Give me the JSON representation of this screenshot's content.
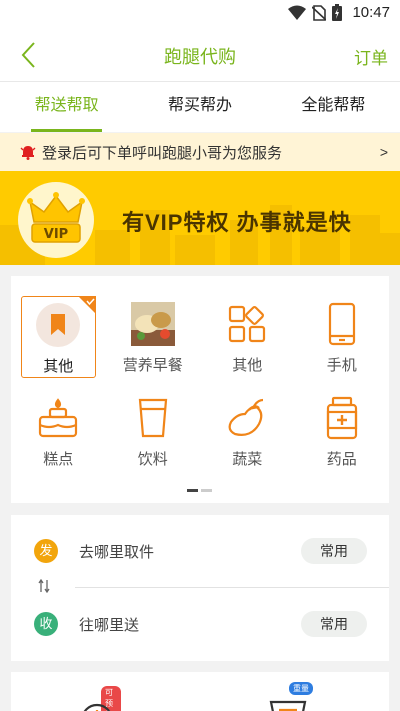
{
  "status_bar": {
    "time": "10:47"
  },
  "header": {
    "title": "跑腿代购",
    "order_label": "订单"
  },
  "tabs": [
    {
      "label": "帮送帮取",
      "active": true
    },
    {
      "label": "帮买帮办",
      "active": false
    },
    {
      "label": "全能帮帮",
      "active": false
    }
  ],
  "notice": {
    "text": "登录后可下单呼叫跑腿小哥为您服务",
    "arrow": ">"
  },
  "vip": {
    "badge_text": "VIP",
    "slogan": "有VIP特权  办事就是快"
  },
  "categories": [
    {
      "label": "其他",
      "icon": "bookmark-icon",
      "selected": true
    },
    {
      "label": "营养早餐",
      "icon": "breakfast-photo",
      "selected": false
    },
    {
      "label": "其他",
      "icon": "grid-shapes-icon",
      "selected": false
    },
    {
      "label": "手机",
      "icon": "phone-icon",
      "selected": false
    },
    {
      "label": "糕点",
      "icon": "cake-icon",
      "selected": false
    },
    {
      "label": "饮料",
      "icon": "cup-icon",
      "selected": false
    },
    {
      "label": "蔬菜",
      "icon": "eggplant-icon",
      "selected": false
    },
    {
      "label": "药品",
      "icon": "medicine-icon",
      "selected": false
    }
  ],
  "address": {
    "pickup": {
      "badge": "发",
      "placeholder": "去哪里取件",
      "common_label": "常用"
    },
    "deliver": {
      "badge": "收",
      "placeholder": "往哪里送",
      "common_label": "常用"
    }
  },
  "bottom": {
    "left_tag": "可预约",
    "right_tag": "重量"
  },
  "colors": {
    "accent_green": "#7ab51d",
    "orange": "#f08519",
    "vip_yellow": "#ffcb00",
    "pickup_badge": "#f2a50c",
    "deliver_badge": "#39b07a"
  }
}
